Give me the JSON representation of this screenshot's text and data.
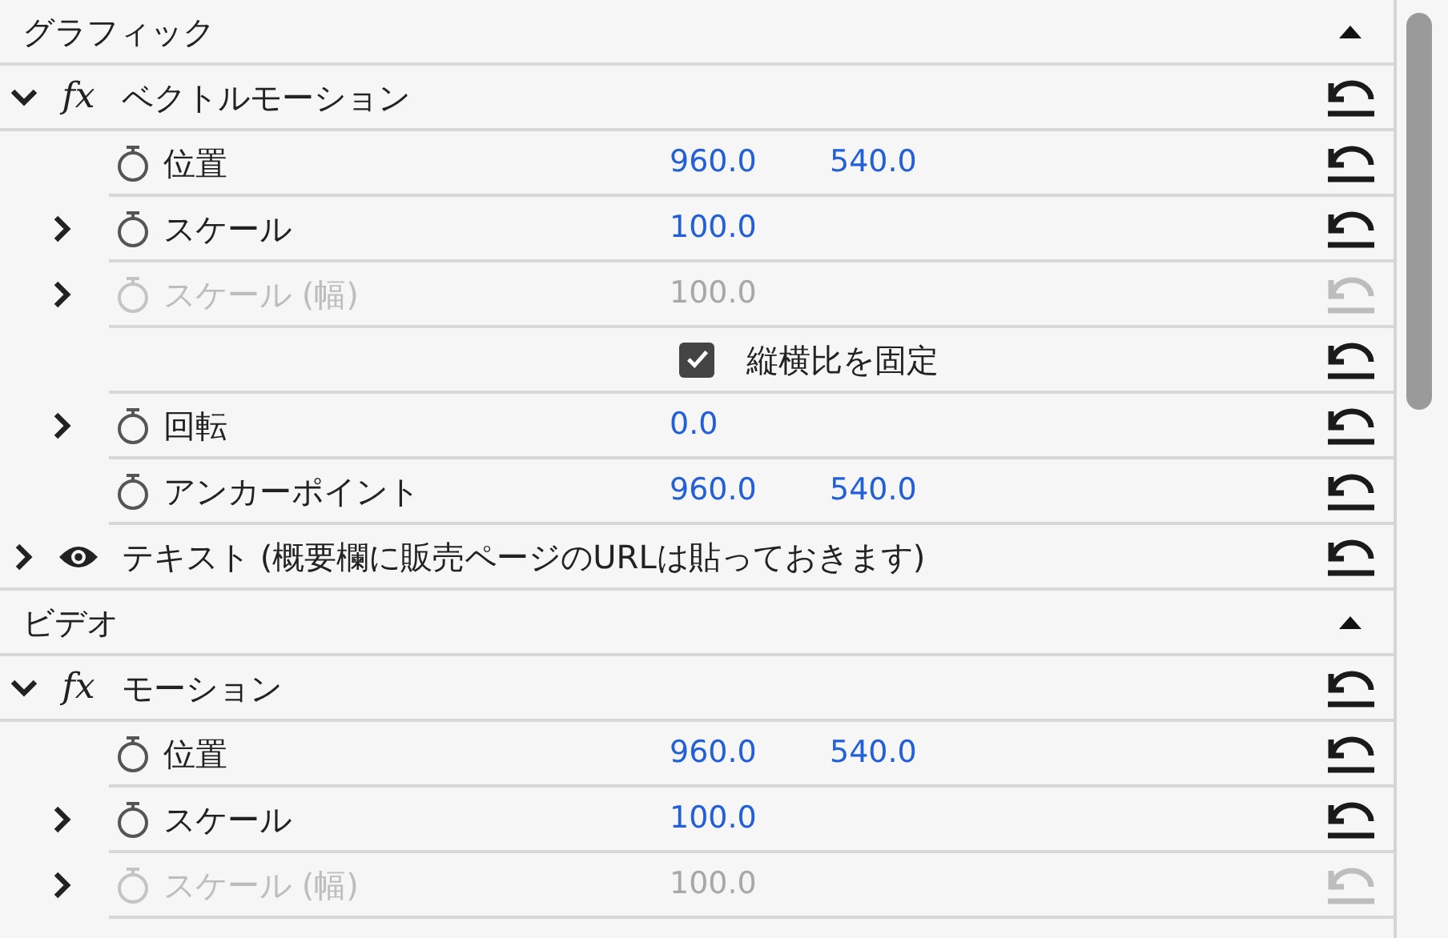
{
  "sections": [
    {
      "title": "グラフィック",
      "expanded": true,
      "effects": [
        {
          "kind": "fx",
          "label": "fx",
          "name": "ベクトルモーション",
          "expanded": true,
          "params": [
            {
              "kind": "param",
              "name": "位置",
              "values": [
                "960.0",
                "540.0"
              ],
              "disabled": false
            },
            {
              "kind": "param",
              "name": "スケール",
              "values": [
                "100.0"
              ],
              "expanded": false,
              "disabled": false
            },
            {
              "kind": "param",
              "name": "スケール (幅)",
              "values": [
                "100.0"
              ],
              "expanded": false,
              "disabled": true
            },
            {
              "kind": "checkbox",
              "name": "縦横比を固定",
              "checked": true,
              "disabled": false
            },
            {
              "kind": "param",
              "name": "回転",
              "values": [
                "0.0"
              ],
              "expanded": false,
              "disabled": false
            },
            {
              "kind": "param",
              "name": "アンカーポイント",
              "values": [
                "960.0",
                "540.0"
              ],
              "disabled": false
            }
          ]
        },
        {
          "kind": "layer",
          "name": "テキスト (概要欄に販売ページのURLは貼っておきます)",
          "expanded": false
        }
      ]
    },
    {
      "title": "ビデオ",
      "expanded": true,
      "effects": [
        {
          "kind": "fx",
          "label": "fx",
          "name": "モーション",
          "expanded": true,
          "params": [
            {
              "kind": "param",
              "name": "位置",
              "values": [
                "960.0",
                "540.0"
              ],
              "disabled": false
            },
            {
              "kind": "param",
              "name": "スケール",
              "values": [
                "100.0"
              ],
              "expanded": false,
              "disabled": false
            },
            {
              "kind": "param",
              "name": "スケール (幅)",
              "values": [
                "100.0"
              ],
              "expanded": false,
              "disabled": true
            }
          ]
        }
      ]
    }
  ]
}
